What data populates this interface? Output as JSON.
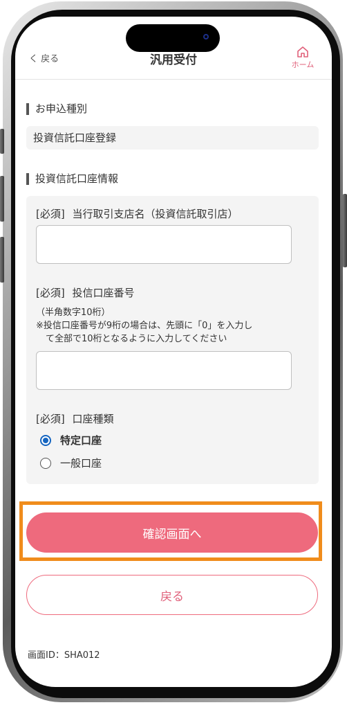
{
  "header": {
    "back_label": "く 戻る",
    "title": "汎用受付",
    "home_label": "ホーム"
  },
  "application_type": {
    "section_title": "お申込種別",
    "value": "投資信託口座登録"
  },
  "account_info": {
    "section_title": "投資信託口座情報",
    "branch_field": {
      "required": "[必須]",
      "label": "当行取引支店名（投資信託取引店）",
      "value": ""
    },
    "account_number_field": {
      "required": "[必須]",
      "label": "投信口座番号",
      "note1": "（半角数字10桁）",
      "note2": "※投信口座番号が9桁の場合は、先頭に「0」を入力し",
      "note3": "て全部で10桁となるように入力してください",
      "value": ""
    },
    "account_type": {
      "required": "[必須]",
      "label": "口座種類",
      "options": [
        "特定口座",
        "一般口座"
      ],
      "selected": "特定口座"
    }
  },
  "buttons": {
    "confirm": "確認画面へ",
    "back": "戻る"
  },
  "footer": {
    "screen_id": "画面ID：SHA012"
  },
  "colors": {
    "accent": "#ee6a7d",
    "highlight": "#f08c1c",
    "radio": "#1565c0"
  }
}
